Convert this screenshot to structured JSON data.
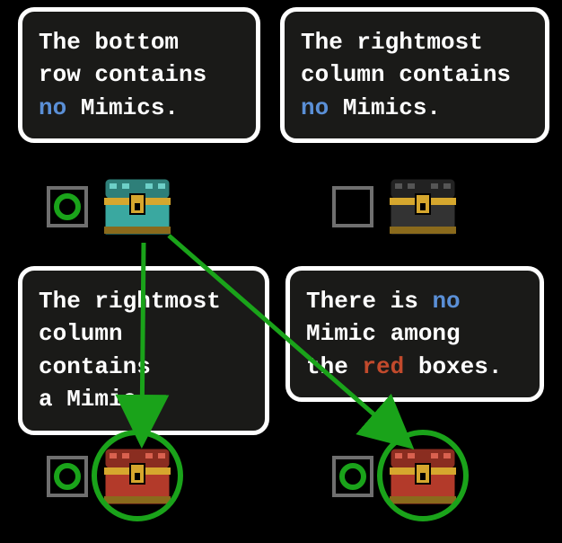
{
  "panels": [
    {
      "id": "top-left",
      "lines": [
        {
          "text": "The bottom",
          "keyword": null
        },
        {
          "text": "row contains",
          "keyword": null
        },
        {
          "text": "no Mimics.",
          "keyword": "no"
        }
      ],
      "checkbox": "marked-circle",
      "chest_color": "teal",
      "highlighted": false
    },
    {
      "id": "top-right",
      "lines": [
        {
          "text": "The rightmost",
          "keyword": null
        },
        {
          "text": "column contains",
          "keyword": null
        },
        {
          "text": "no Mimics.",
          "keyword": "no"
        }
      ],
      "checkbox": "empty",
      "chest_color": "black",
      "highlighted": false
    },
    {
      "id": "bottom-left",
      "lines": [
        {
          "text": "The rightmost",
          "keyword": null
        },
        {
          "text": "column contains",
          "keyword": null
        },
        {
          "text": "a Mimic.",
          "keyword": null
        }
      ],
      "checkbox": "marked-circle",
      "chest_color": "red",
      "highlighted": true
    },
    {
      "id": "bottom-right",
      "lines": [
        {
          "text": "There is no",
          "keyword": "no"
        },
        {
          "text": "Mimic among",
          "keyword": null
        },
        {
          "text": "the red boxes.",
          "keyword": "red"
        }
      ],
      "checkbox": "marked-circle",
      "chest_color": "red",
      "highlighted": true
    }
  ],
  "colors": {
    "teal_body": "#3aa8a0",
    "teal_lid": "#2e7f79",
    "black_body": "#333333",
    "black_lid": "#222222",
    "red_body": "#b33a2a",
    "red_lid": "#8a2d20",
    "gold": "#d6a72e",
    "gold_dark": "#8a6a1c",
    "circle_green": "#1aa31a",
    "arrow_green": "#1aa31a"
  },
  "arrows": [
    {
      "from": "top-left-chest",
      "to": "bottom-left-chest"
    },
    {
      "from": "top-left-chest",
      "to": "bottom-right-chest"
    }
  ]
}
